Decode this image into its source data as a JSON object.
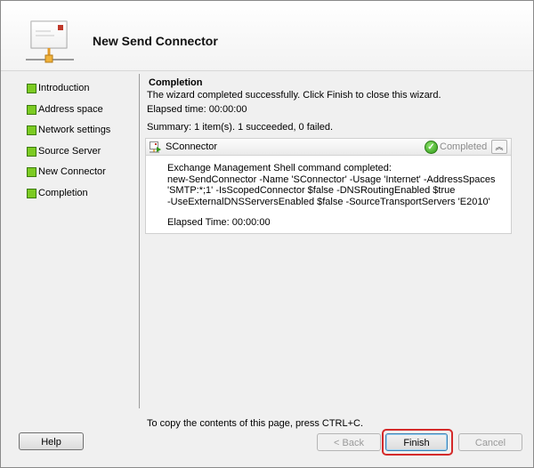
{
  "window": {
    "title": "New Send Connector"
  },
  "nav": {
    "items": [
      {
        "label": "Introduction"
      },
      {
        "label": "Address space"
      },
      {
        "label": "Network settings"
      },
      {
        "label": "Source Server"
      },
      {
        "label": "New Connector"
      },
      {
        "label": "Completion"
      }
    ],
    "status_color": "#7ccb22"
  },
  "main": {
    "section_title": "Completion",
    "message": "The wizard completed successfully. Click Finish to close this wizard.",
    "elapsed": "Elapsed time: 00:00:00",
    "summary": "Summary: 1 item(s). 1 succeeded, 0 failed.",
    "result": {
      "name": "SConnector",
      "status": "Completed",
      "status_icon": "check-icon",
      "output_lines": [
        "Exchange Management Shell command completed:",
        "new-SendConnector -Name 'SConnector' -Usage 'Internet' -AddressSpaces",
        "'SMTP:*;1' -IsScopedConnector $false -DNSRoutingEnabled $true",
        "-UseExternalDNSServersEnabled $false -SourceTransportServers 'E2010'"
      ],
      "elapsed": "Elapsed Time: 00:00:00"
    },
    "copy_hint": "To copy the contents of this page, press CTRL+C."
  },
  "buttons": {
    "help": "Help",
    "back": "< Back",
    "finish": "Finish",
    "cancel": "Cancel"
  },
  "colors": {
    "highlight": "#d42a2a",
    "success": "#2f9a17"
  }
}
